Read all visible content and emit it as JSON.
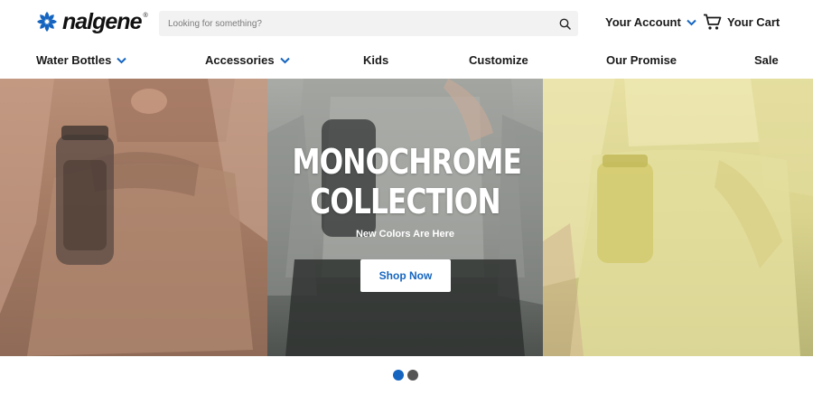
{
  "brand": {
    "logo_text": "nalgene",
    "logo_mark_symbol": "®",
    "logo_icon": "nalgene-swirl-icon",
    "accent_color": "#1565c0"
  },
  "search": {
    "placeholder": "Looking for something?",
    "value": "",
    "icon": "search-icon"
  },
  "header": {
    "account_label": "Your Account",
    "account_icon": "chevron-down-icon",
    "cart_label": "Your Cart",
    "cart_icon": "cart-icon"
  },
  "nav": {
    "items": [
      {
        "label": "Water Bottles",
        "has_dropdown": true
      },
      {
        "label": "Accessories",
        "has_dropdown": true
      },
      {
        "label": "Kids",
        "has_dropdown": false
      },
      {
        "label": "Customize",
        "has_dropdown": false
      },
      {
        "label": "Our Promise",
        "has_dropdown": false
      },
      {
        "label": "Sale",
        "has_dropdown": false
      }
    ]
  },
  "hero": {
    "title_line1": "MONOCHROME",
    "title_line2": "COLLECTION",
    "subtitle": "New Colors Are Here",
    "cta_label": "Shop Now",
    "panels": [
      "tan-monochrome-photo",
      "gray-monochrome-photo",
      "yellow-monochrome-photo"
    ]
  },
  "carousel": {
    "slides": 2,
    "active": 1,
    "active_color": "#1565c0",
    "inactive_color": "#555555"
  }
}
